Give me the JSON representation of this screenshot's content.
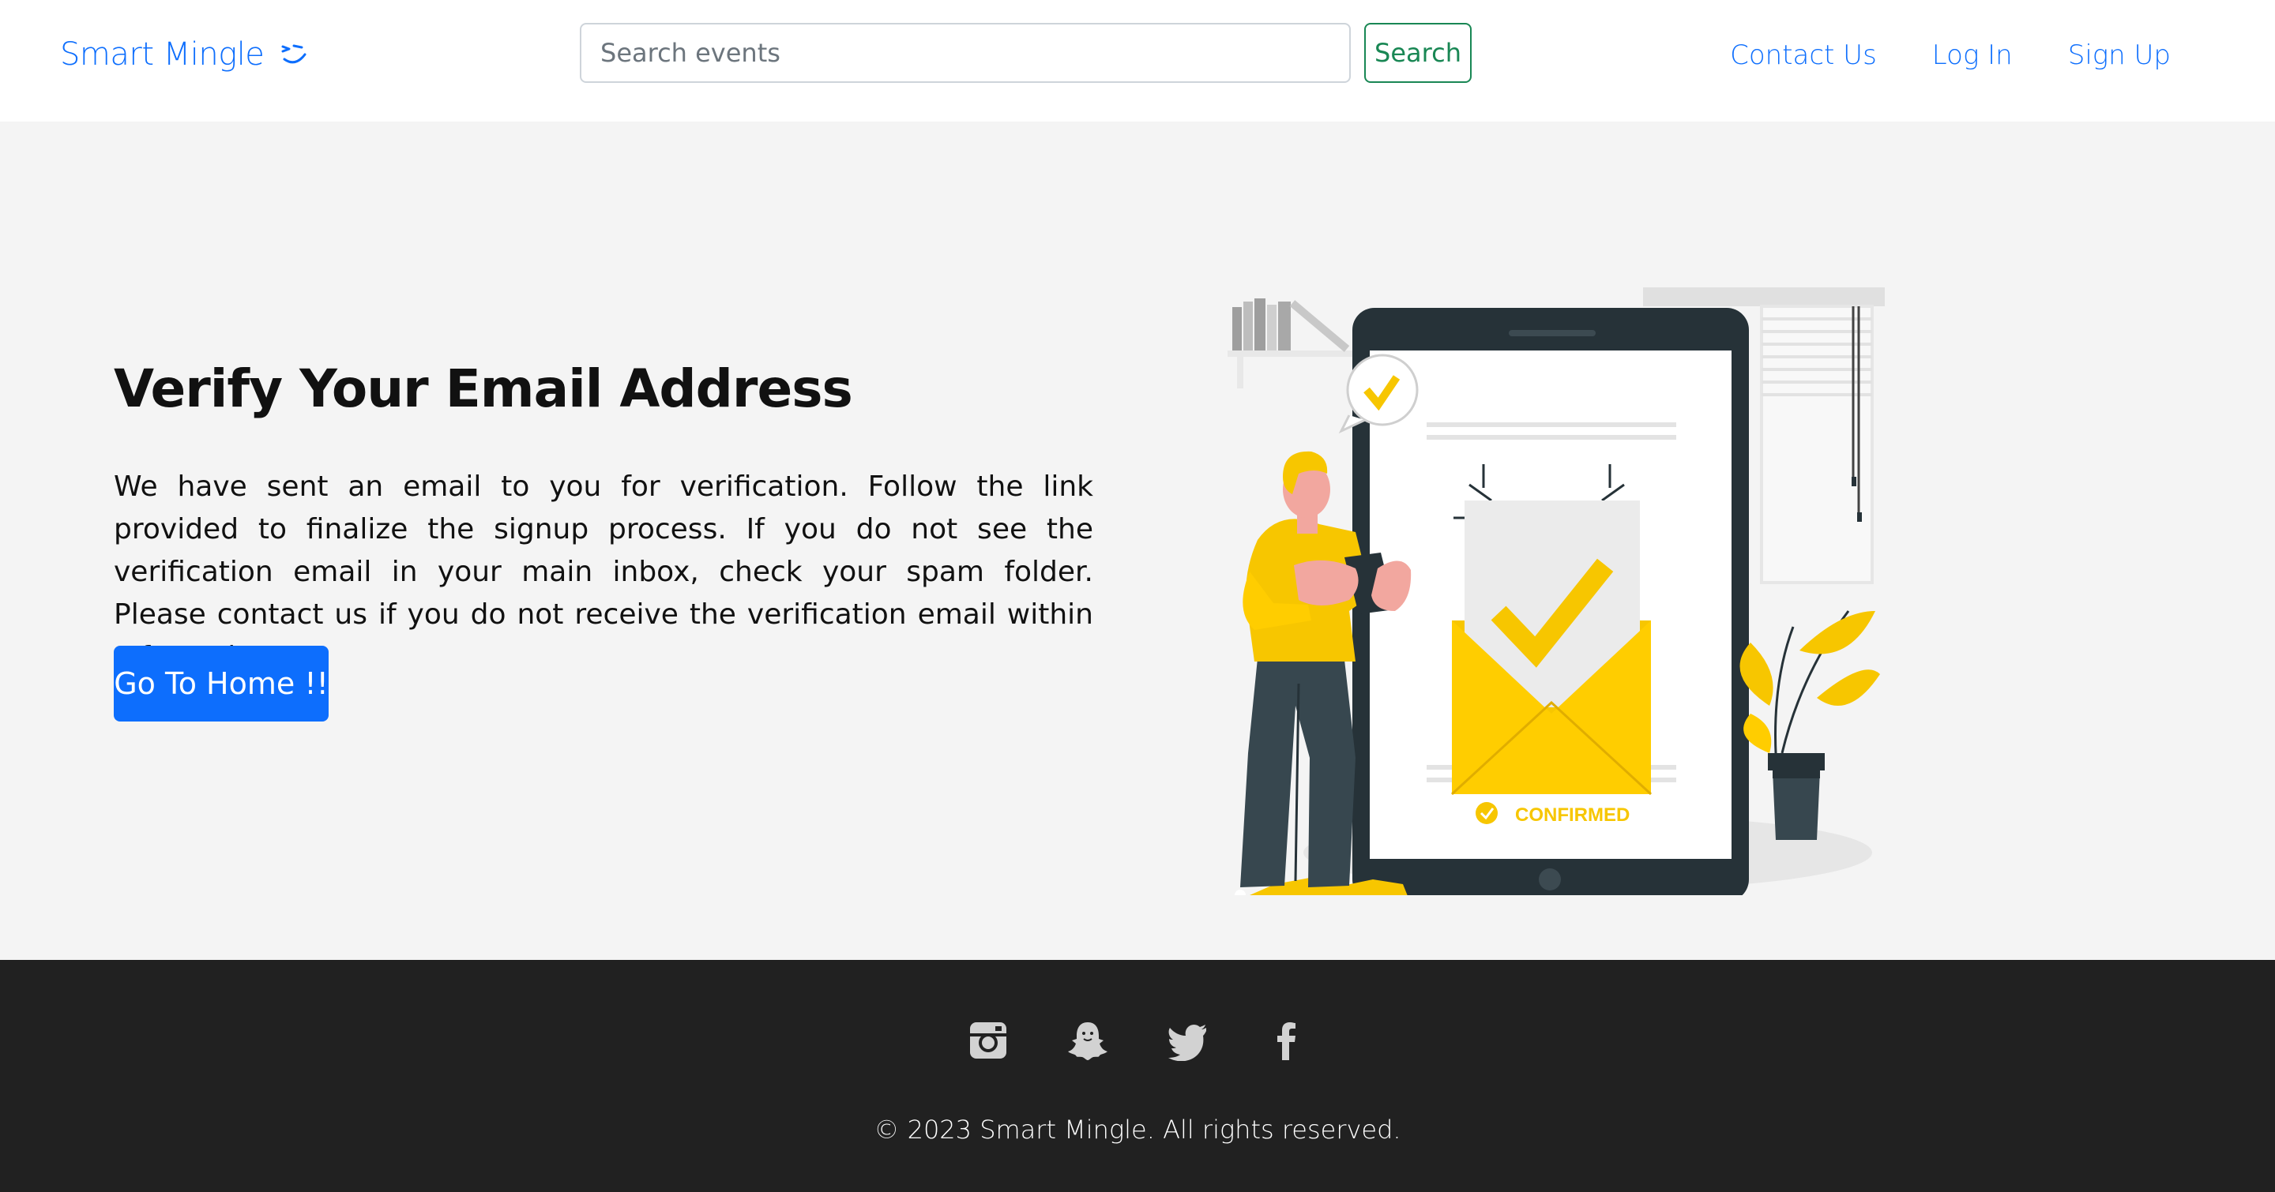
{
  "navbar": {
    "brand": "Smart Mingle",
    "brand_icon": "smile-wink-icon",
    "search": {
      "placeholder": "Search events",
      "value": "",
      "button_label": "Search"
    },
    "links": [
      {
        "label": "Contact Us"
      },
      {
        "label": "Log In"
      },
      {
        "label": "Sign Up"
      }
    ]
  },
  "hero": {
    "title": "Verify Your Email Address",
    "text": "We have sent an email to you for verification. Follow the link provided to finalize the signup process. If you do not see the verification email in your main inbox, check your spam folder. Please contact us if you do not receive the verification email within a few minutes.",
    "button_label": "Go To Home !!",
    "illustration": {
      "confirmed_label": "CONFIRMED"
    }
  },
  "footer": {
    "social": [
      {
        "icon": "instagram-icon"
      },
      {
        "icon": "snapchat-icon"
      },
      {
        "icon": "twitter-icon"
      },
      {
        "icon": "facebook-icon"
      }
    ],
    "copyright": "© 2023 Smart Mingle. All rights reserved."
  },
  "colors": {
    "primary": "#0d6efd",
    "success": "#198754",
    "hero_background": "#f4f4f4",
    "footer_background": "#212121",
    "illustration_accent": "#f7c600",
    "illustration_dark": "#263238"
  }
}
